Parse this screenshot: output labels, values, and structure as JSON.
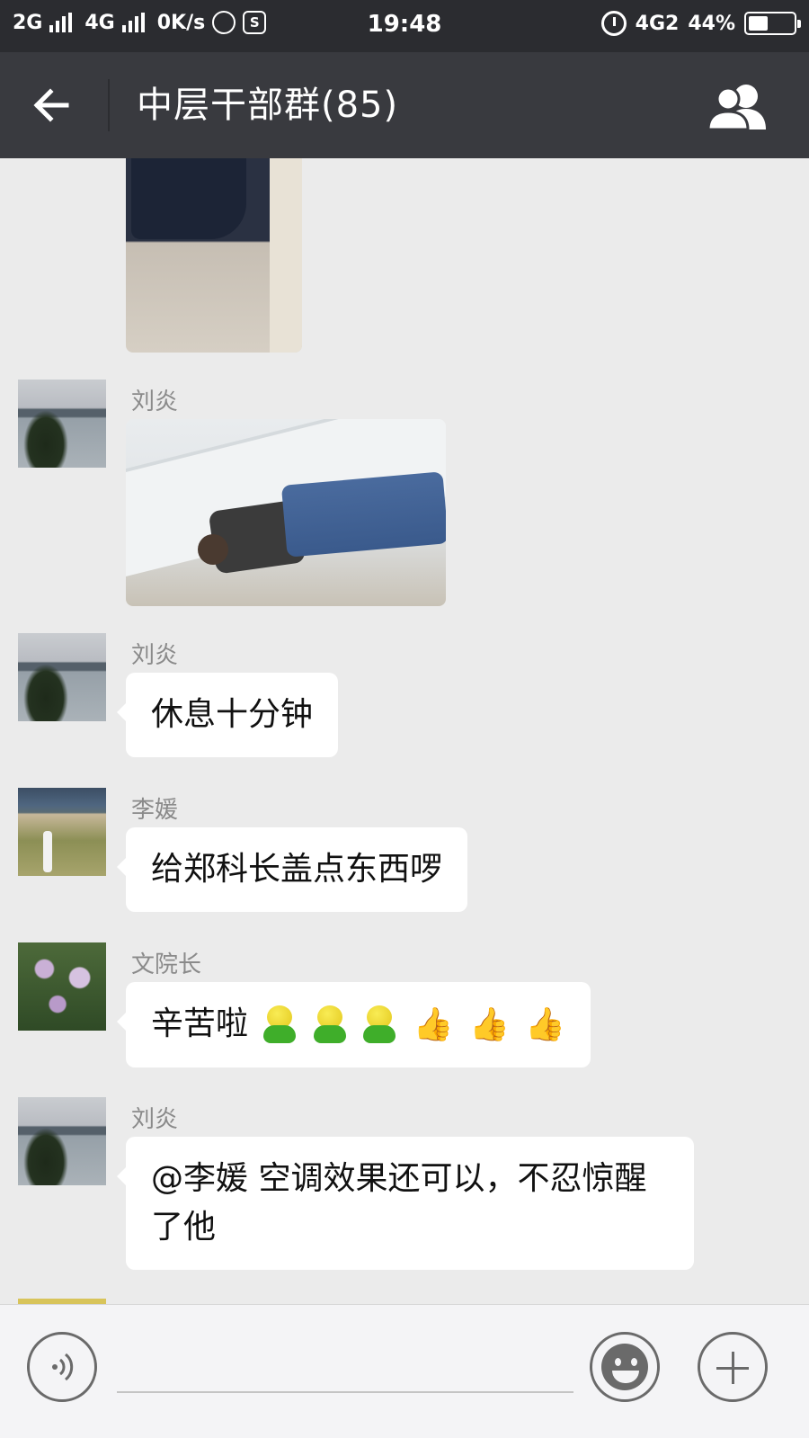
{
  "status_bar": {
    "network1": "2G",
    "network2": "4G",
    "speed": "0K/s",
    "app_icon": "S",
    "time": "19:48",
    "network3": "4G2",
    "battery": "44%",
    "battery_level": 0.44
  },
  "header": {
    "title": "中层干部群(85)"
  },
  "messages": [
    {
      "type": "image",
      "sender": "",
      "image": "floor-photo"
    },
    {
      "type": "image",
      "sender": "刘炎",
      "image": "room-photo"
    },
    {
      "type": "text",
      "sender": "刘炎",
      "text": "休息十分钟"
    },
    {
      "type": "text",
      "sender": "李媛",
      "text": "给郑科长盖点东西啰"
    },
    {
      "type": "text",
      "sender": "文院长",
      "text": "辛苦啦",
      "emoji": [
        "green-bear-emoji",
        "green-bear-emoji",
        "green-bear-emoji",
        "thumbs-up-emoji",
        "thumbs-up-emoji",
        "thumbs-up-emoji"
      ]
    },
    {
      "type": "text",
      "sender": "刘炎",
      "text": "@李媛 空调效果还可以，不忍惊醒了他"
    }
  ],
  "icons": {
    "back": "back-arrow-icon",
    "members": "group-members-icon",
    "voice": "voice-icon",
    "emoji": "emoji-icon",
    "plus": "plus-icon"
  }
}
